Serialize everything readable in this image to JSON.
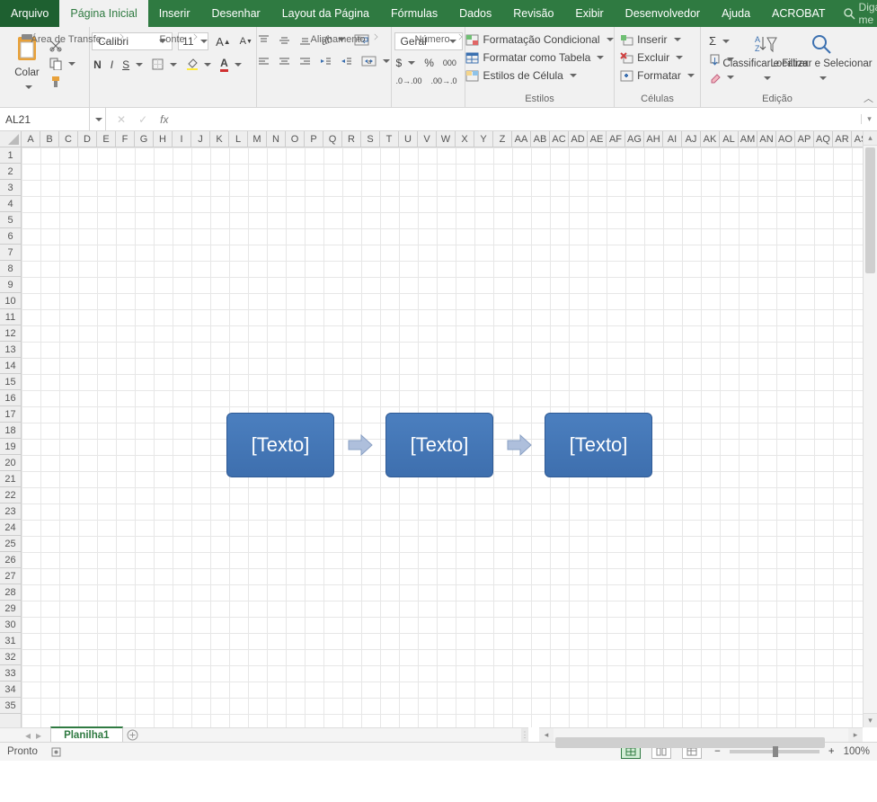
{
  "tabs": {
    "file": "Arquivo",
    "home": "Página Inicial",
    "insert": "Inserir",
    "draw": "Desenhar",
    "layout": "Layout da Página",
    "formulas": "Fórmulas",
    "data": "Dados",
    "review": "Revisão",
    "view": "Exibir",
    "developer": "Desenvolvedor",
    "help": "Ajuda",
    "acrobat": "ACROBAT",
    "tellme": "Diga-me"
  },
  "clipboard": {
    "paste": "Colar",
    "group": "Área de Transfe…"
  },
  "font": {
    "name": "Calibri",
    "size": "11",
    "bold": "N",
    "italic": "I",
    "underline": "S",
    "group": "Fonte"
  },
  "align": {
    "group": "Alinhamento"
  },
  "number": {
    "format": "Geral",
    "group": "Número"
  },
  "styles": {
    "cond": "Formatação Condicional",
    "table": "Formatar como Tabela",
    "cell": "Estilos de Célula",
    "group": "Estilos"
  },
  "cells_group": {
    "insert": "Inserir",
    "delete": "Excluir",
    "format": "Formatar",
    "group": "Células"
  },
  "editing": {
    "sort": "Classificar e Filtrar",
    "find": "Localizar e Selecionar",
    "group": "Edição"
  },
  "namebox": "AL21",
  "columns": [
    "A",
    "B",
    "C",
    "D",
    "E",
    "F",
    "G",
    "H",
    "I",
    "J",
    "K",
    "L",
    "M",
    "N",
    "O",
    "P",
    "Q",
    "R",
    "S",
    "T",
    "U",
    "V",
    "W",
    "X",
    "Y",
    "Z",
    "AA",
    "AB",
    "AC",
    "AD",
    "AE",
    "AF",
    "AG",
    "AH",
    "AI",
    "AJ",
    "AK",
    "AL",
    "AM",
    "AN",
    "AO",
    "AP",
    "AQ",
    "AR",
    "AS"
  ],
  "row_count": 35,
  "smartart": {
    "t1": "[Texto]",
    "t2": "[Texto]",
    "t3": "[Texto]"
  },
  "sheet": {
    "name": "Planilha1"
  },
  "status": {
    "ready": "Pronto",
    "zoom": "100%"
  },
  "glyph": {
    "currency": "$",
    "percent": "%",
    "thousands": "000",
    "sigma": "Σ"
  }
}
